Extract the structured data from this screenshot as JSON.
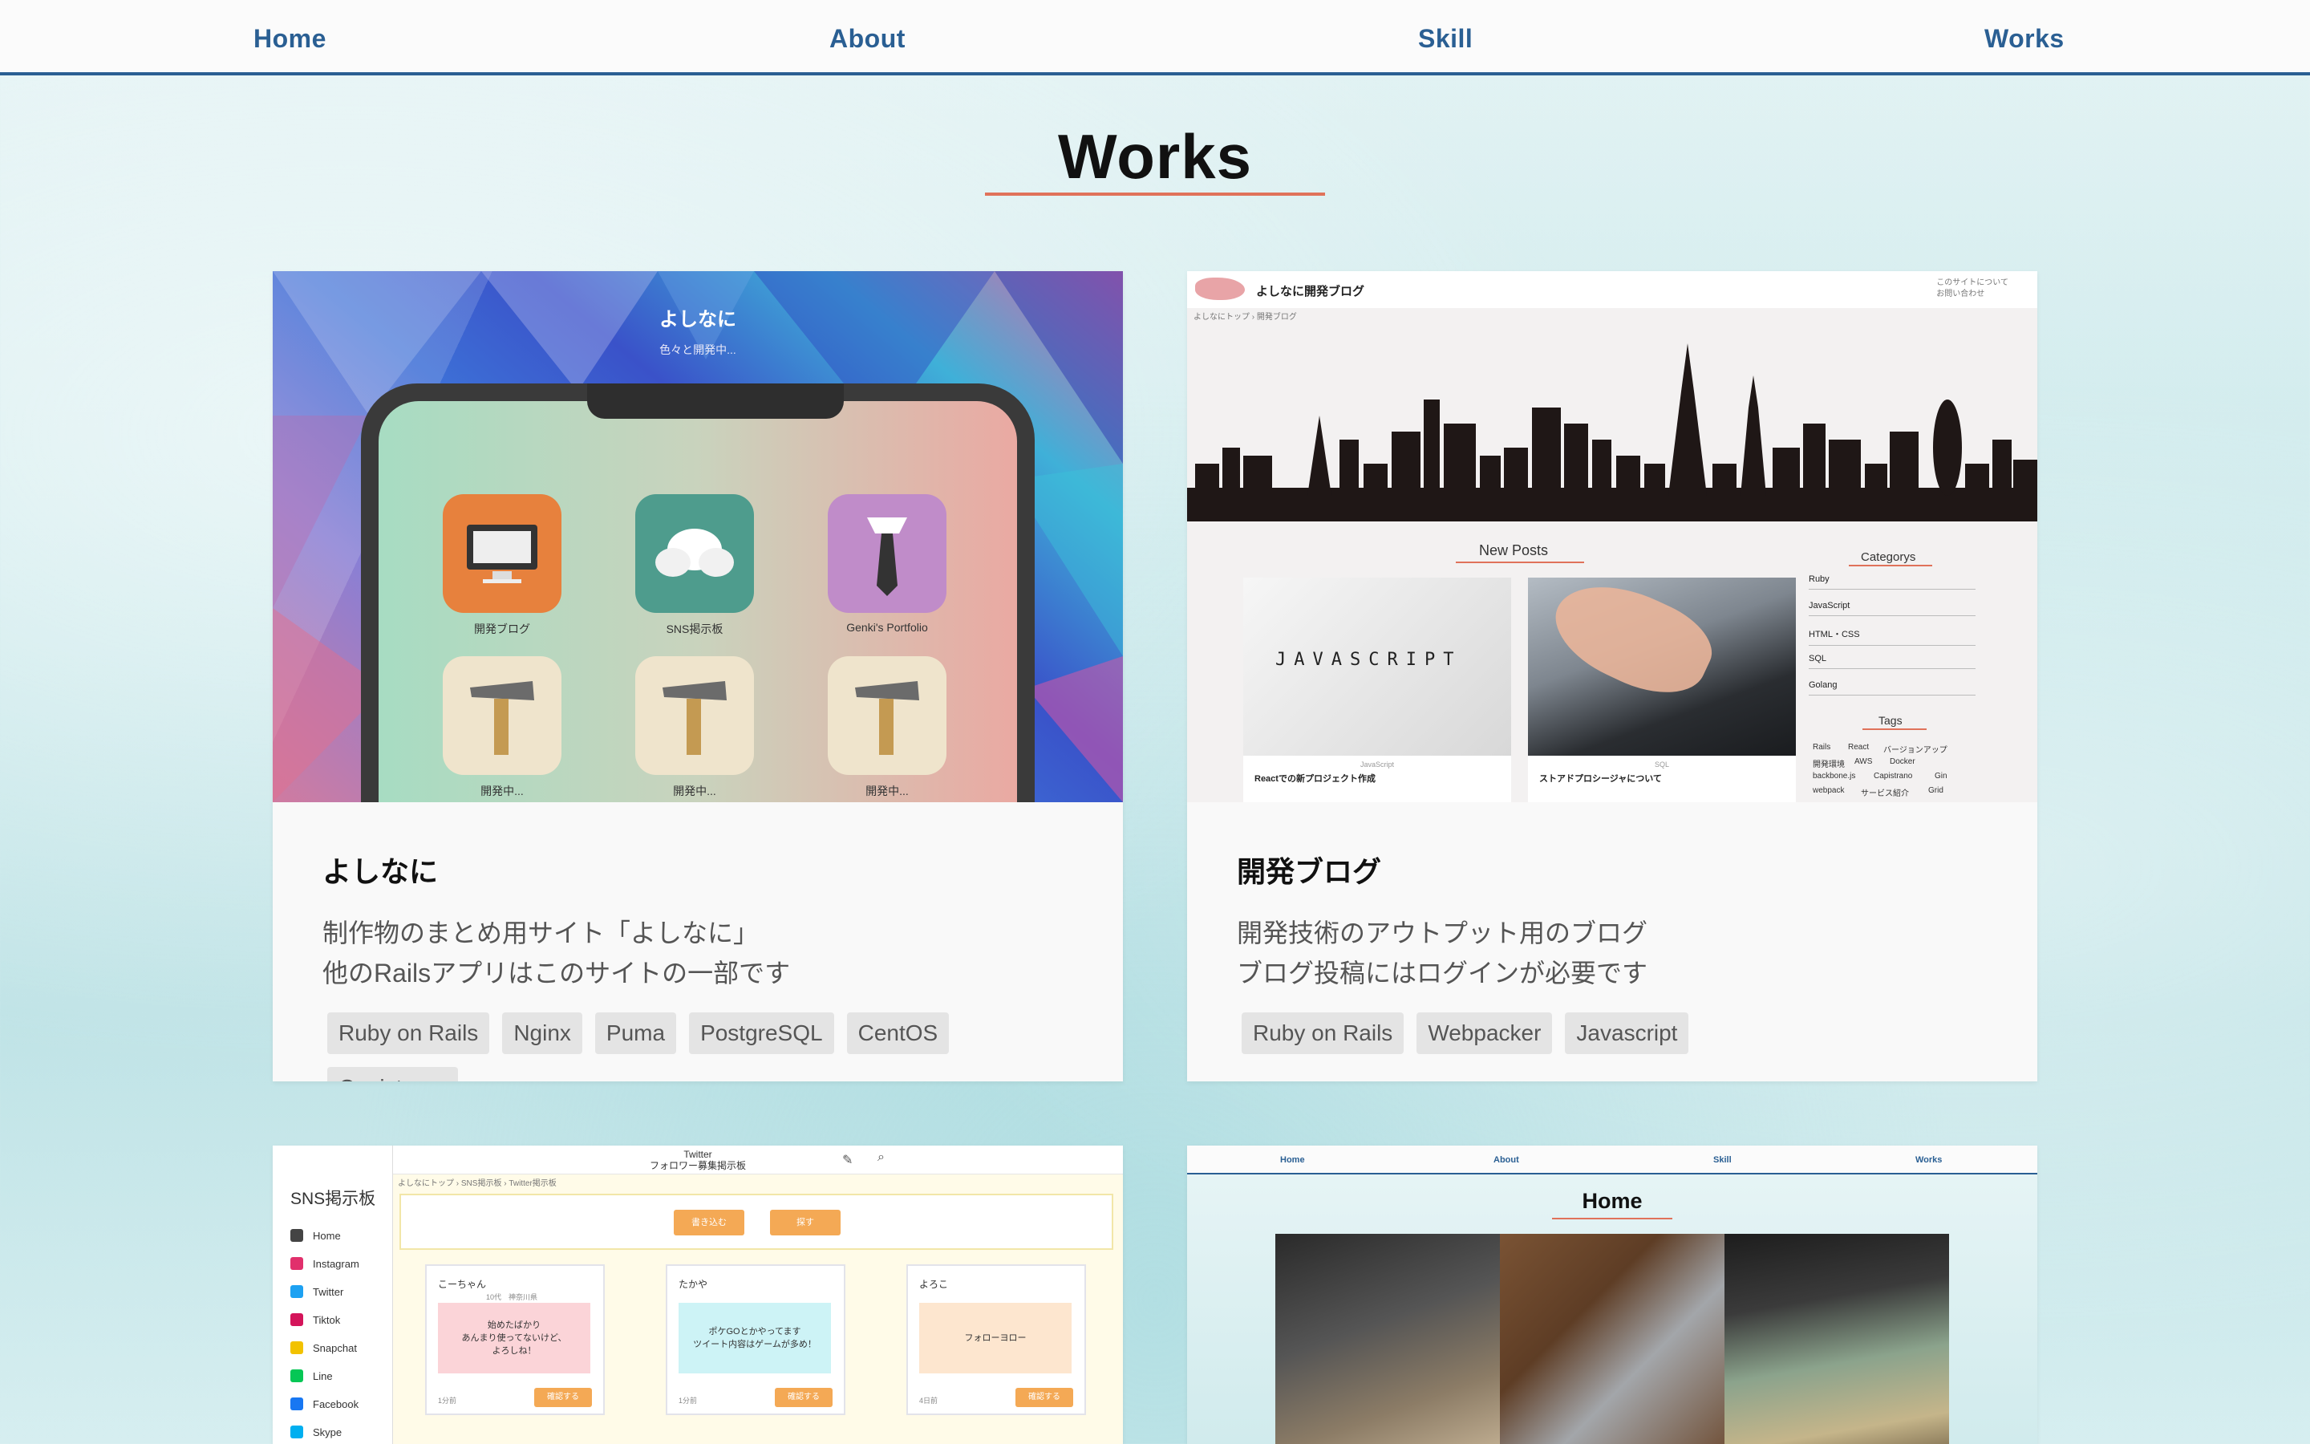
{
  "nav": {
    "home": "Home",
    "about": "About",
    "skill": "Skill",
    "works": "Works"
  },
  "section": {
    "title": "Works"
  },
  "colors": {
    "nav_accent": "#2a5f93",
    "underline_accent": "#e0725a",
    "tag_bg": "#e4e4e4"
  },
  "works": [
    {
      "title": "よしなに",
      "desc_line1": "制作物のまとめ用サイト「よしなに」",
      "desc_line2": "他のRailsアプリはこのサイトの一部です",
      "tags": [
        "Ruby on Rails",
        "Nginx",
        "Puma",
        "PostgreSQL",
        "CentOS",
        "Capistrano"
      ],
      "thumb": {
        "title": "よしなに",
        "subtitle": "色々と開発中...",
        "apps": [
          {
            "label": "開発ブログ",
            "icon": "monitor-icon"
          },
          {
            "label": "SNS掲示板",
            "icon": "chat-bubbles-icon"
          },
          {
            "label": "Genki's Portfolio",
            "icon": "necktie-icon"
          },
          {
            "label": "開発中...",
            "icon": "hammer-icon"
          },
          {
            "label": "開発中...",
            "icon": "hammer-icon"
          },
          {
            "label": "開発中...",
            "icon": "hammer-icon"
          }
        ]
      }
    },
    {
      "title": "開発ブログ",
      "desc_line1": "開発技術のアウトプット用のブログ",
      "desc_line2": "ブログ投稿にはログインが必要です",
      "tags": [
        "Ruby on Rails",
        "Webpacker",
        "Javascript"
      ],
      "thumb": {
        "site_name": "よしなに開発ブログ",
        "header_right_1": "このサイトについて",
        "header_right_2": "お問い合わせ",
        "breadcrumb": "よしなにトップ › 開発ブログ",
        "new_posts": "New Posts",
        "categories_title": "Categorys",
        "categories": [
          "Ruby",
          "JavaScript",
          "HTML・CSS",
          "SQL",
          "Golang"
        ],
        "tags_title": "Tags",
        "tag_words": [
          "Rails",
          "React",
          "バージョンアップ",
          "開発環境",
          "AWS",
          "Docker",
          "backbone.js",
          "Capistrano",
          "Gin",
          "webpack",
          "サービス紹介",
          "Grid"
        ],
        "posts": [
          {
            "category": "JavaScript",
            "title": "Reactでの新プロジェクト作成",
            "image_text": "JAVASCRIPT"
          },
          {
            "category": "SQL",
            "title": "ストアドプロシージャについて"
          }
        ]
      }
    },
    {
      "thumb": {
        "sidebar_title": "SNS掲示板",
        "sidebar_items": [
          "Home",
          "Instagram",
          "Twitter",
          "Tiktok",
          "Snapchat",
          "Line",
          "Facebook",
          "Skype"
        ],
        "top_title_1": "Twitter",
        "top_title_2": "フォロワー募集掲示板",
        "breadcrumb": "よしなにトップ › SNS掲示板 › Twitter掲示板",
        "btn_write": "書き込む",
        "btn_search": "探す",
        "posts": [
          {
            "name": "こーちゃん",
            "age": "10代　神奈川県",
            "text": "始めたばかり\nあんまり使ってないけど、\nよろしね！",
            "time": "1分前",
            "confirm": "確認する"
          },
          {
            "name": "たかや",
            "age": "",
            "text": "ポケGOとかやってます\nツイート内容はゲームが多め！",
            "time": "1分前",
            "confirm": "確認する"
          },
          {
            "name": "よろこ",
            "age": "",
            "text": "フォローヨロー",
            "time": "4日前",
            "confirm": "確認する"
          }
        ]
      }
    },
    {
      "thumb": {
        "nav": [
          "Home",
          "About",
          "Skill",
          "Works"
        ],
        "title": "Home"
      }
    }
  ]
}
